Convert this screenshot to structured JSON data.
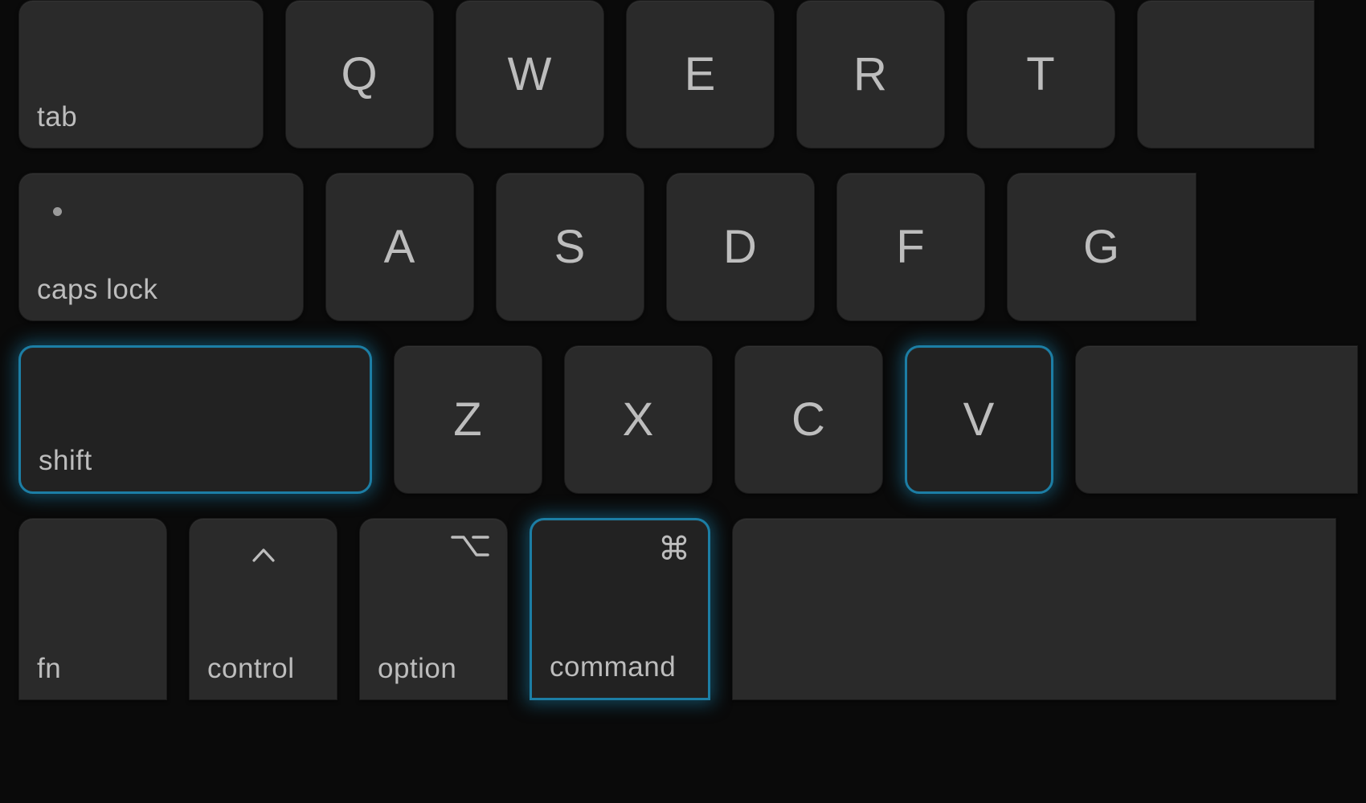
{
  "colors": {
    "highlight": "#1c7ea5",
    "keycap": "#2a2a2a",
    "background": "#0a0a0a",
    "text": "#bdbdbd"
  },
  "rows": {
    "r1": {
      "tab": "tab",
      "letters": [
        "Q",
        "W",
        "E",
        "R",
        "T"
      ]
    },
    "r2": {
      "caps": "caps lock",
      "letters": [
        "A",
        "S",
        "D",
        "F",
        "G"
      ]
    },
    "r3": {
      "shift": "shift",
      "letters": [
        "Z",
        "X",
        "C",
        "V"
      ]
    },
    "r4": {
      "fn": "fn",
      "control": "control",
      "option": "option",
      "command": "command",
      "command_symbol": "⌘"
    }
  },
  "highlighted_keys": [
    "shift",
    "V",
    "command"
  ]
}
